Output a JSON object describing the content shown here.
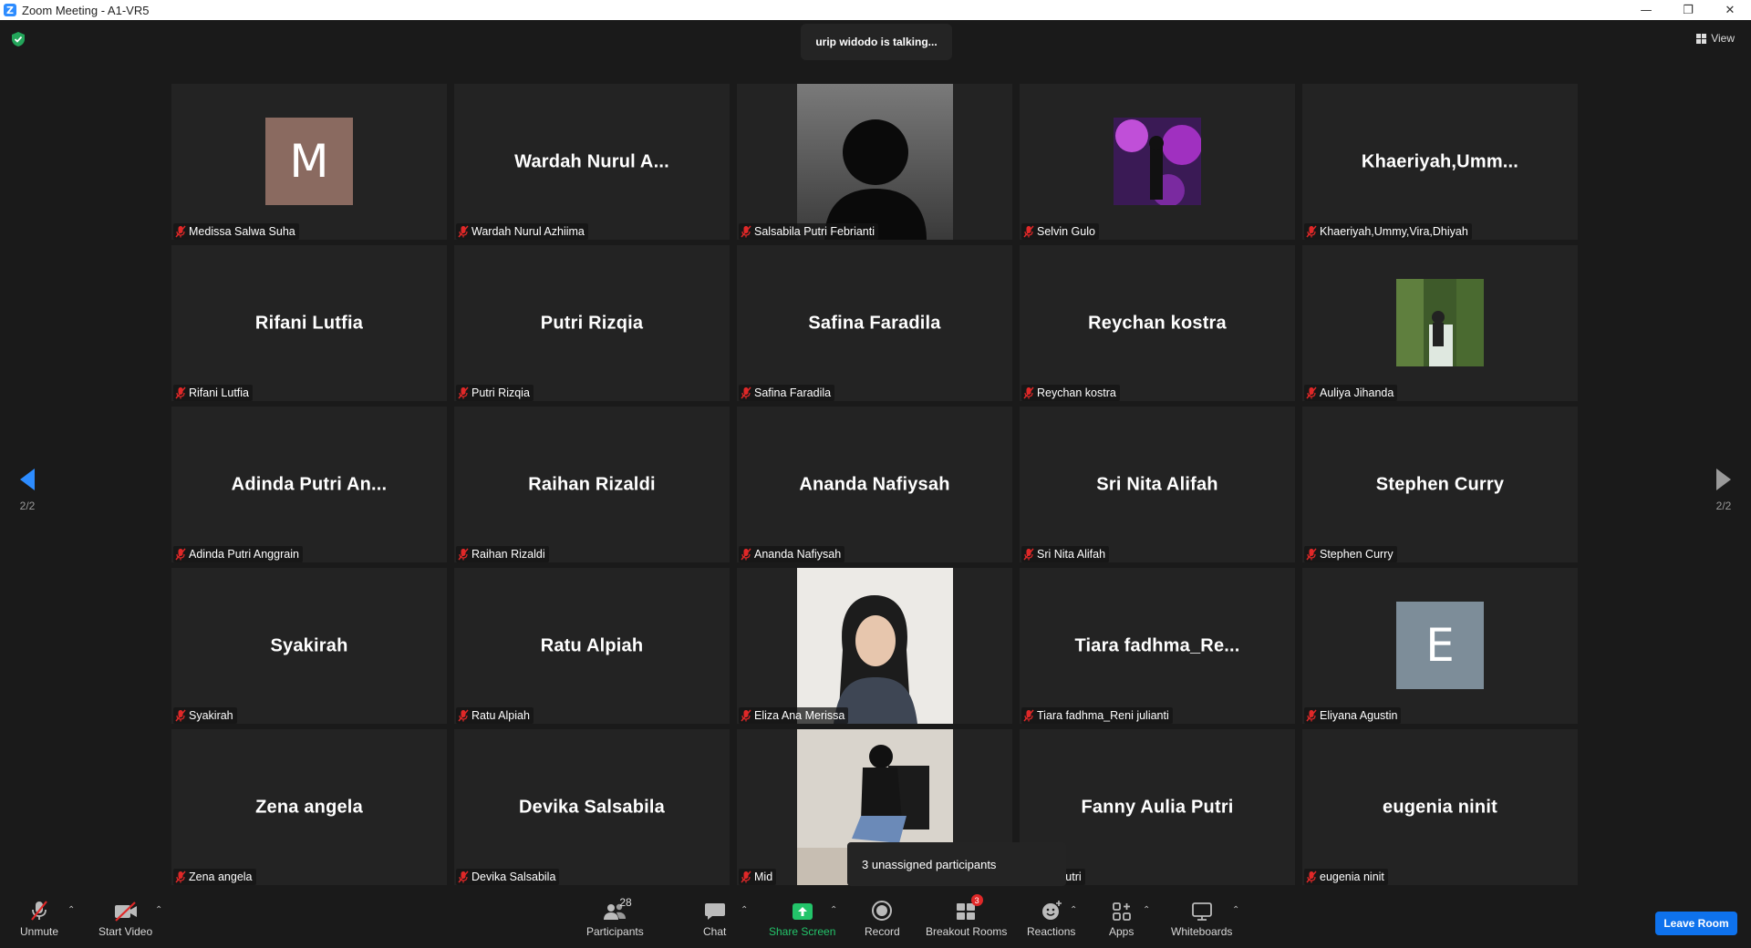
{
  "window": {
    "title": "Zoom Meeting - A1-VR5",
    "logo_letter": "Z"
  },
  "status": {
    "talking": "urip widodo is talking..."
  },
  "view_button": {
    "label": "View"
  },
  "pagination": {
    "left": "2/2",
    "right": "2/2"
  },
  "tiles": [
    {
      "label": "Medissa Salwa Suha",
      "avatar_letter": "M",
      "avatar_color": "#8a6a60"
    },
    {
      "label": "Wardah Nurul Azhiima",
      "big": "Wardah Nurul A..."
    },
    {
      "label": "Salsabila Putri Febrianti"
    },
    {
      "label": "Selvin Gulo"
    },
    {
      "label": "Khaeriyah,Ummy,Vira,Dhiyah",
      "big": "Khaeriyah,Umm..."
    },
    {
      "label": "Rifani Lutfia",
      "big": "Rifani Lutfia"
    },
    {
      "label": "Putri Rizqia",
      "big": "Putri Rizqia"
    },
    {
      "label": "Safina Faradila",
      "big": "Safina Faradila"
    },
    {
      "label": "Reychan kostra",
      "big": "Reychan kostra"
    },
    {
      "label": "Auliya Jihanda"
    },
    {
      "label": "Adinda Putri Anggrain",
      "big": "Adinda Putri An..."
    },
    {
      "label": "Raihan Rizaldi",
      "big": "Raihan Rizaldi"
    },
    {
      "label": "Ananda Nafiysah",
      "big": "Ananda Nafiysah"
    },
    {
      "label": "Sri Nita Alifah",
      "big": "Sri Nita Alifah"
    },
    {
      "label": "Stephen Curry",
      "big": "Stephen Curry"
    },
    {
      "label": "Syakirah",
      "big": "Syakirah"
    },
    {
      "label": "Ratu Alpiah",
      "big": "Ratu Alpiah"
    },
    {
      "label": "Eliza Ana Merissa"
    },
    {
      "label": "Tiara fadhma_Reni julianti",
      "big": "Tiara fadhma_Re..."
    },
    {
      "label": "Eliyana Agustin",
      "avatar_letter": "E",
      "avatar_color": "#7d8d99"
    },
    {
      "label": "Zena angela",
      "big": "Zena angela"
    },
    {
      "label": "Devika Salsabila",
      "big": "Devika Salsabila"
    },
    {
      "label": "Mid"
    },
    {
      "label": "ulia Putri",
      "big": "Fanny Aulia Putri"
    },
    {
      "label": "eugenia ninit",
      "big": "eugenia ninit"
    }
  ],
  "notice": {
    "unassigned": "3 unassigned participants"
  },
  "toolbar": {
    "unmute": "Unmute",
    "start_video": "Start Video",
    "participants": "Participants",
    "participants_count": "28",
    "chat": "Chat",
    "share_screen": "Share Screen",
    "record": "Record",
    "breakout_rooms": "Breakout Rooms",
    "breakout_badge": "3",
    "reactions": "Reactions",
    "apps": "Apps",
    "whiteboards": "Whiteboards",
    "leave_room": "Leave Room"
  },
  "colors": {
    "accent": "#0e72ed",
    "share": "#23c46a",
    "muted_mic": "#e02828",
    "tile_bg": "#232323"
  },
  "icons": [
    "zoom-logo-icon",
    "shield-check-icon",
    "grid-view-icon",
    "mic-off-icon",
    "video-off-icon",
    "participants-icon",
    "chat-icon",
    "share-screen-icon",
    "record-icon",
    "breakout-rooms-icon",
    "reactions-icon",
    "apps-icon",
    "whiteboard-icon",
    "caret-up-icon",
    "arrow-left-icon",
    "arrow-right-icon"
  ]
}
